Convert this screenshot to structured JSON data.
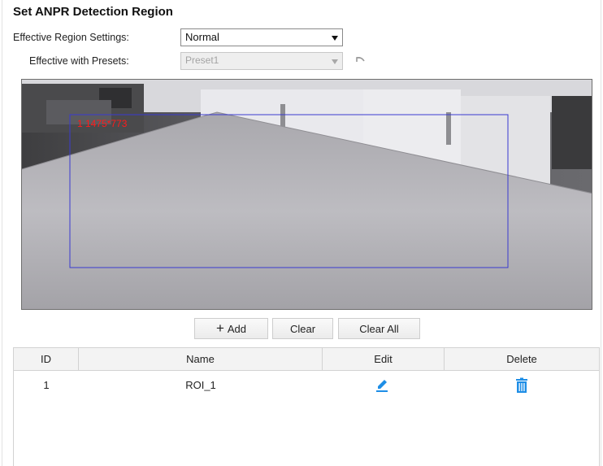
{
  "title": "Set ANPR Detection Region",
  "region_settings": {
    "label": "Effective Region Settings:",
    "value": "Normal"
  },
  "presets": {
    "label": "Effective with Presets:",
    "value": "Preset1",
    "disabled": true,
    "undo_icon": "undo-icon"
  },
  "video": {
    "roi_label": "1 1475*773",
    "roi_color": "#3a3ad0",
    "label_color": "#ff1a1a"
  },
  "buttons": {
    "add": "Add",
    "clear": "Clear",
    "clear_all": "Clear All"
  },
  "table": {
    "headers": {
      "id": "ID",
      "name": "Name",
      "edit": "Edit",
      "delete": "Delete"
    },
    "rows": [
      {
        "id": "1",
        "name": "ROI_1",
        "edit_icon": "pencil-icon",
        "delete_icon": "trash-icon"
      }
    ]
  },
  "colors": {
    "icon_blue": "#1e8ee6"
  }
}
